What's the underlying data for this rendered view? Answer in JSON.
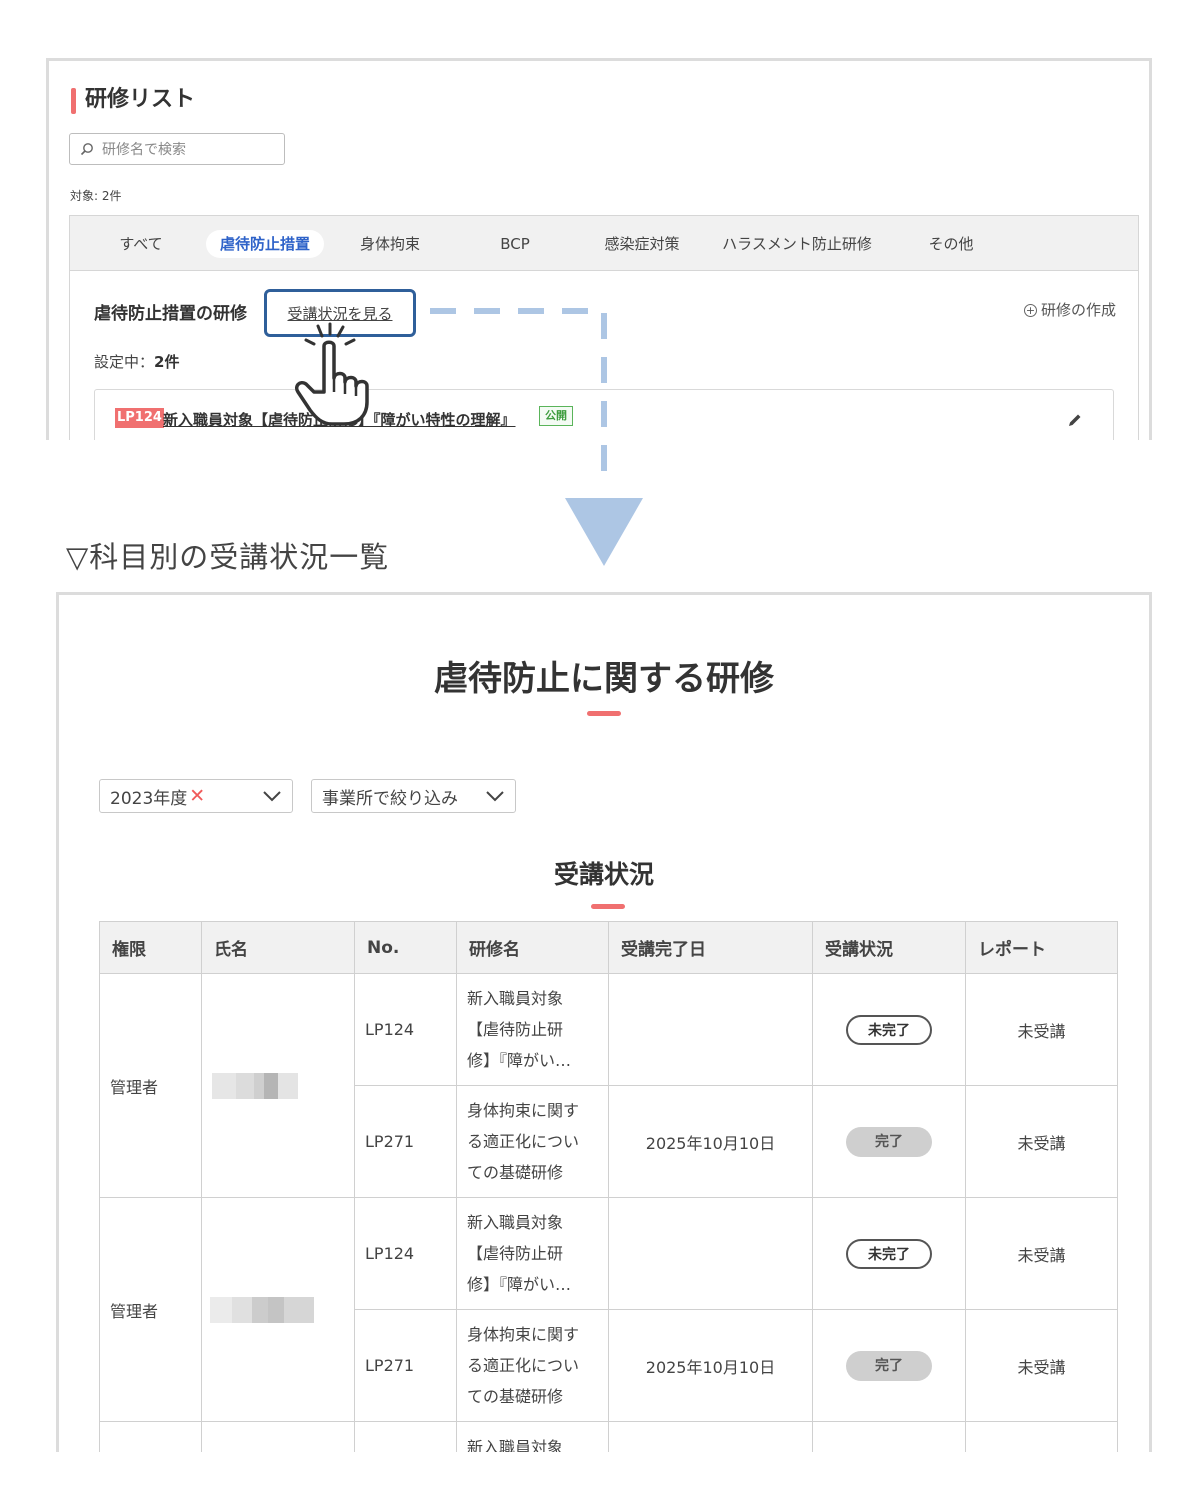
{
  "training_list": {
    "title": "研修リスト",
    "search_placeholder": "研修名で検索",
    "count": "対象: 2件",
    "tabs": [
      "すべて",
      "虐待防止措置",
      "身体拘束",
      "BCP",
      "感染症対策",
      "ハラスメント防止研修",
      "その他"
    ],
    "active_tab": "虐待防止措置",
    "section_title": "虐待防止措置の研修",
    "view_status_link": "受講状況を見る",
    "create_label": "研修の作成",
    "setting_label": "設定中：",
    "setting_count": "2件",
    "course": {
      "code": "LP124",
      "title": "新入職員対象【虐待防止研修】『障がい特性の理解』",
      "public_badge": "公開"
    }
  },
  "caption": "▽科目別の受講状況一覧",
  "status_page": {
    "title": "虐待防止に関する研修",
    "year_filter": "2023年度",
    "year_clear": "✕",
    "office_filter": "事業所で絞り込み",
    "section_title": "受講状況",
    "columns": [
      "権限",
      "氏名",
      "No.",
      "研修名",
      "受講完了日",
      "受講状況",
      "レポート"
    ],
    "users": [
      {
        "role": "管理者",
        "rows": [
          {
            "no": "LP124",
            "title_lines": [
              "新入職員対象",
              "【虐待防止研",
              "修】『障がい…"
            ],
            "date": "",
            "status": "未完了",
            "report": "未受講"
          },
          {
            "no": "LP271",
            "title_lines": [
              "身体拘束に関す",
              "る適正化につい",
              "ての基礎研修"
            ],
            "date": "2025年10月10日",
            "status": "完了",
            "report": "未受講"
          }
        ]
      },
      {
        "role": "管理者",
        "rows": [
          {
            "no": "LP124",
            "title_lines": [
              "新入職員対象",
              "【虐待防止研",
              "修】『障がい…"
            ],
            "date": "",
            "status": "未完了",
            "report": "未受講"
          },
          {
            "no": "LP271",
            "title_lines": [
              "身体拘束に関す",
              "る適正化につい",
              "ての基礎研修"
            ],
            "date": "2025年10月10日",
            "status": "完了",
            "report": "未受講"
          }
        ]
      }
    ],
    "partial_row_title": "新入職員対象"
  },
  "colors": {
    "accent_red": "#f07070",
    "tab_active_blue": "#2f63c9",
    "highlight_border": "#2f5f9a",
    "connector_blue": "#adc6e4",
    "public_green": "#3e9d3e"
  },
  "icons": [
    "search-icon",
    "plus-circle-icon",
    "pencil-icon",
    "pointer-hand-icon",
    "chevron-down-icon",
    "down-arrow-icon"
  ]
}
